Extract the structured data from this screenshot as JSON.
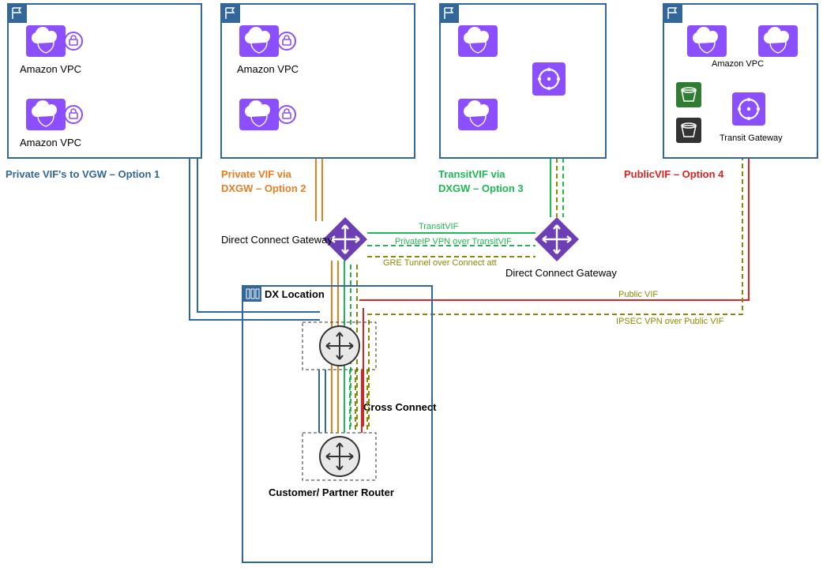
{
  "option1": {
    "l1": "Private VIF's to VGW – Option 1"
  },
  "option2": {
    "l1": "Private VIF via",
    "l2": "DXGW – Option 2"
  },
  "option3": {
    "l1": "TransitVIF via",
    "l2": "DXGW – Option 3"
  },
  "option4": {
    "l1": "PublicVIF – Option 4"
  },
  "labels": {
    "amazonVPC": "Amazon VPC",
    "transitGW": "Transit Gateway",
    "dxgw": "Direct Connect Gateway",
    "dxloc": "DX Location",
    "cross": "Cross Connect",
    "custRouter": "Customer/ Partner Router",
    "transitVIF": "TransitVIF",
    "privIPVPN": "PrivateIP VPN over TransitVIF",
    "gre": "GRE Tunnel over Connect att",
    "publicVIF": "Public VIF",
    "ipsec": "IPSEC VPN over Public VIF"
  },
  "colors": {
    "opt1": "#336699",
    "opt2": "#E67E22",
    "opt3": "#1DB954",
    "opt4": "#D22",
    "olive": "#8A8A00",
    "purple": "#6C3FB5",
    "flag": "#336699"
  }
}
